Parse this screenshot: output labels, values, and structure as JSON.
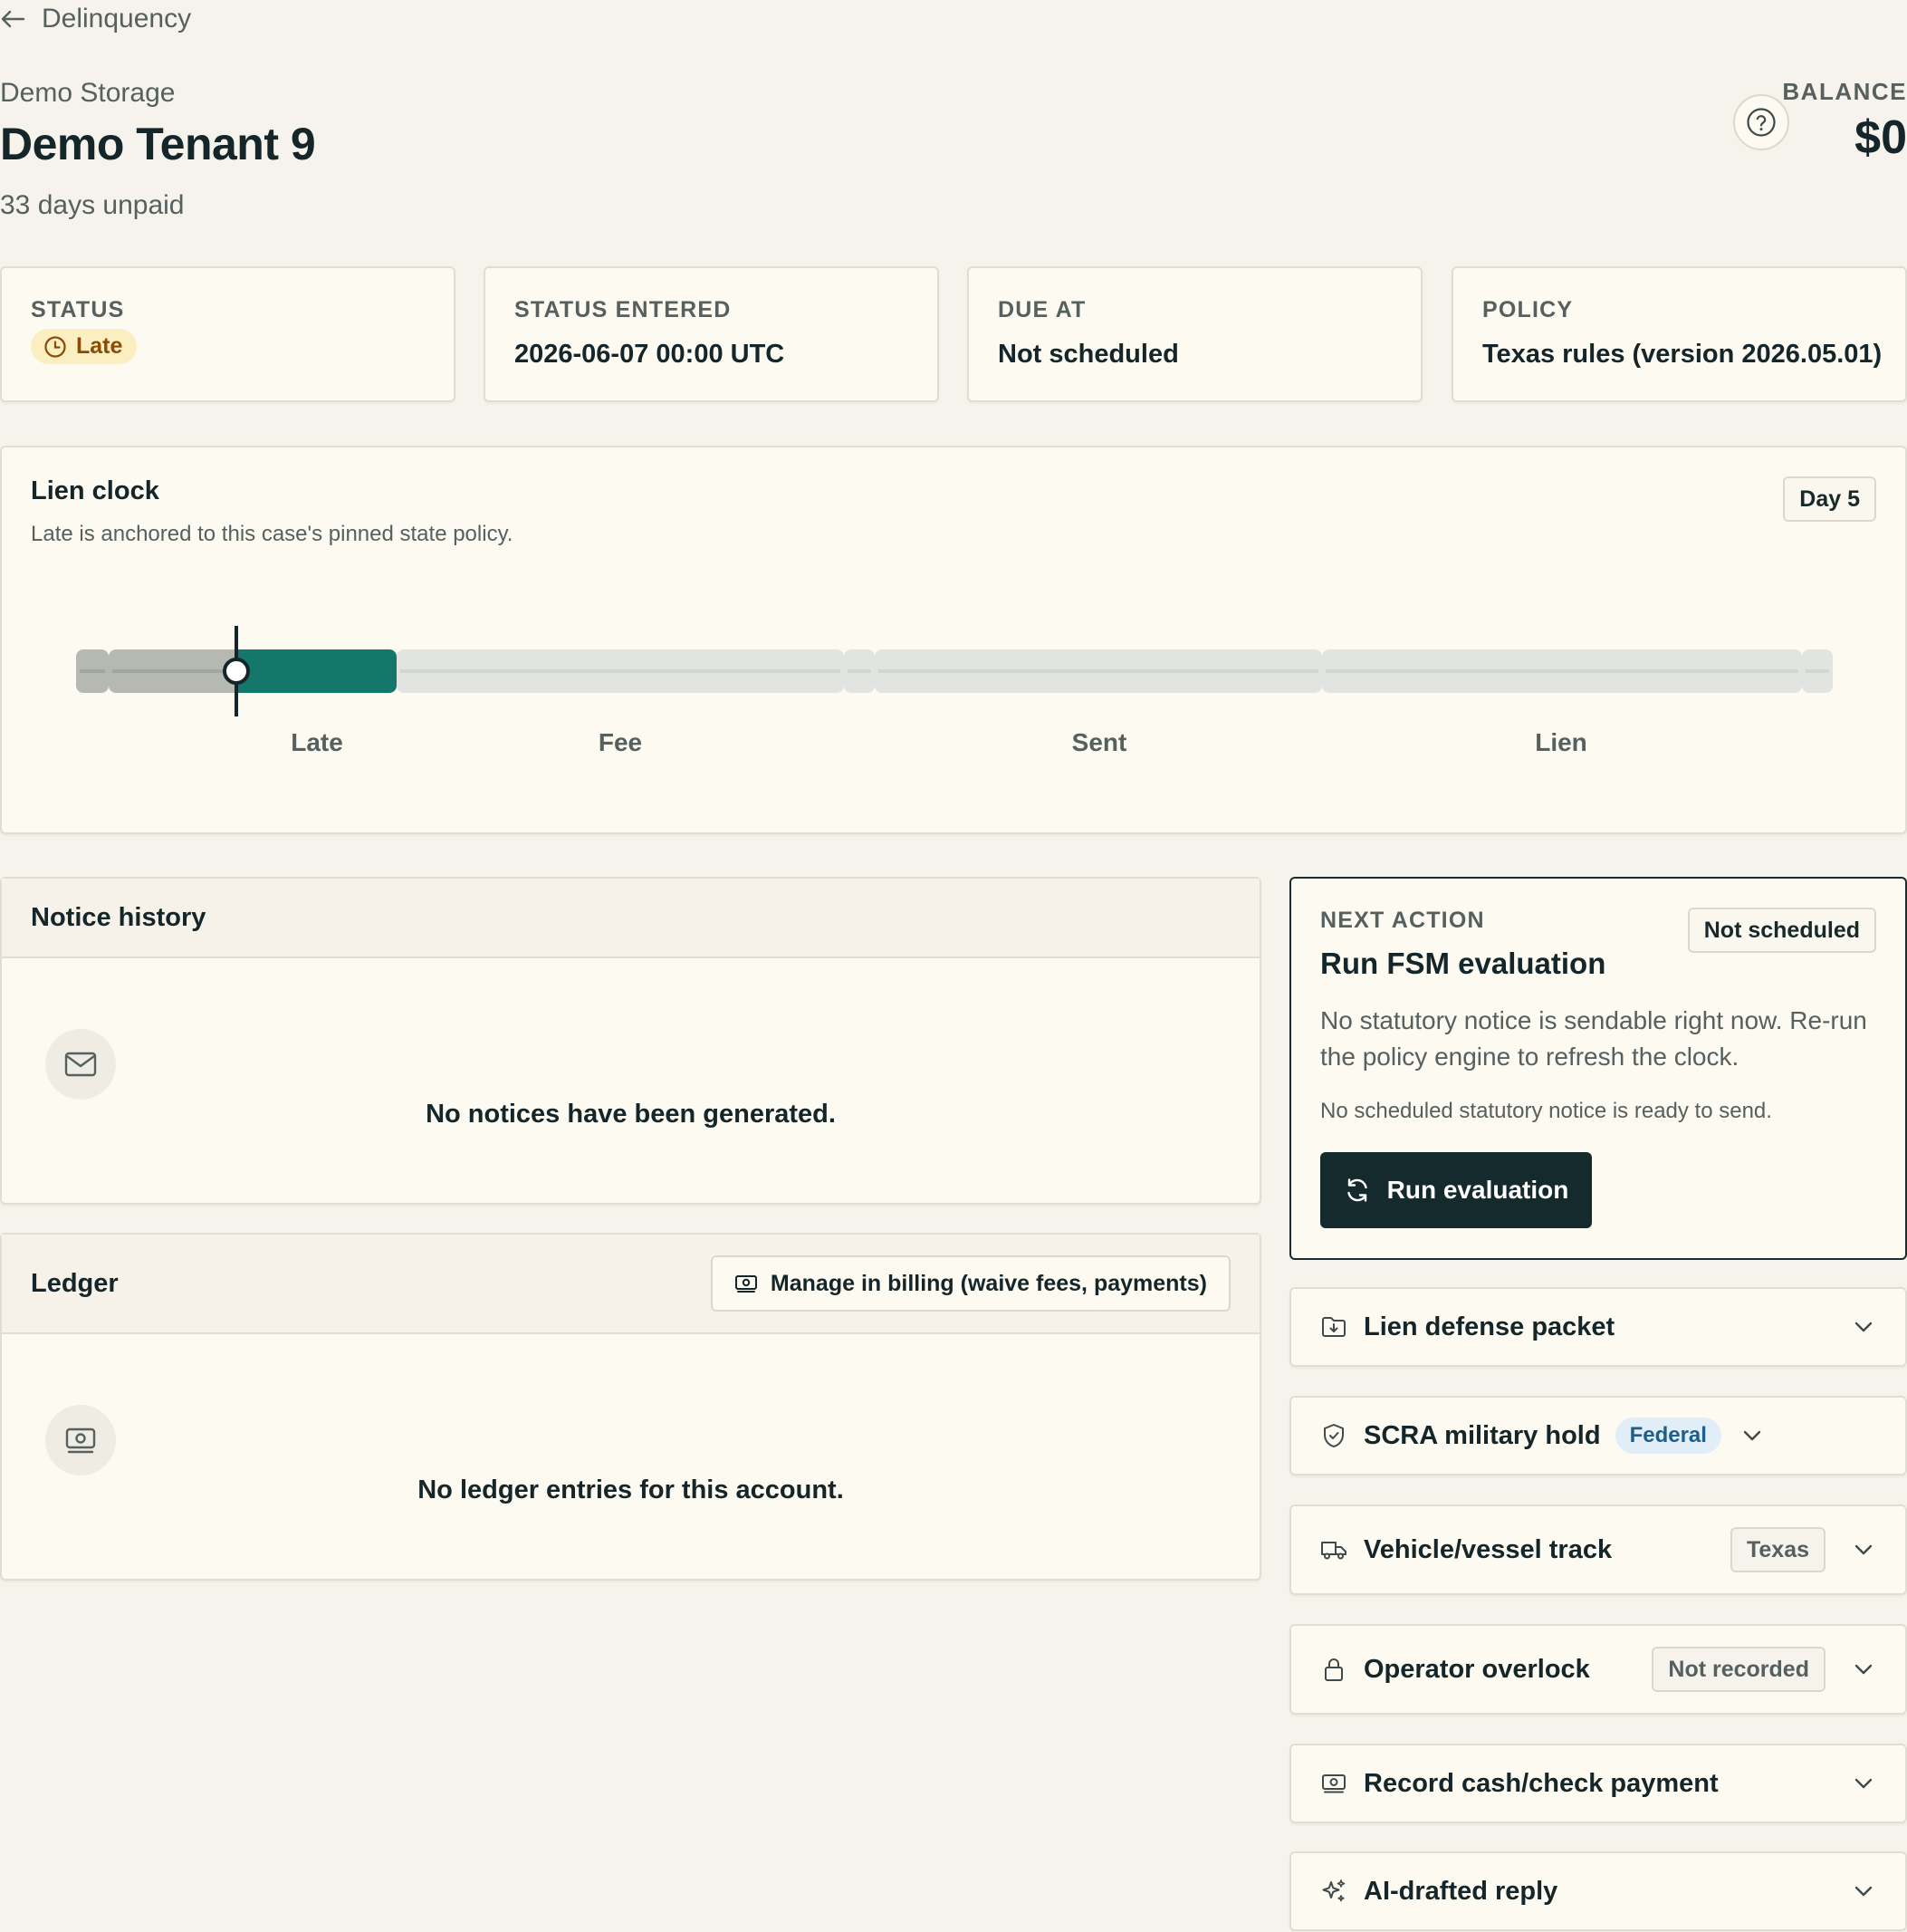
{
  "breadcrumb": {
    "back_label": "Delinquency"
  },
  "header": {
    "facility": "Demo Storage",
    "tenant_name": "Demo Tenant 9",
    "days_unpaid": "33 days unpaid",
    "balance_label": "BALANCE",
    "balance_value": "$0"
  },
  "stats": {
    "status": {
      "label": "STATUS",
      "value": "Late"
    },
    "status_entered": {
      "label": "STATUS ENTERED",
      "value": "2026-06-07 00:00 UTC"
    },
    "due_at": {
      "label": "DUE AT",
      "value": "Not scheduled"
    },
    "policy": {
      "label": "POLICY",
      "value": "Texas rules (version 2026.05.01)"
    }
  },
  "lien_clock": {
    "title": "Lien clock",
    "subtitle": "Late is anchored to this case's pinned state policy.",
    "day_badge": "Day 5",
    "stages": [
      "Late",
      "Fee",
      "Sent",
      "Lien"
    ],
    "colors": {
      "elapsed": "#b6b9b2",
      "current": "#15766a",
      "future": "#e2e4e1"
    }
  },
  "notice_history": {
    "title": "Notice history",
    "icon": "mail-icon",
    "empty_text": "No notices have been generated."
  },
  "ledger": {
    "title": "Ledger",
    "billing_button": "Manage in billing (waive fees, payments)",
    "icon": "cash-icon",
    "empty_text": "No ledger entries for this account."
  },
  "next_action": {
    "label": "NEXT ACTION",
    "badge": "Not scheduled",
    "title": "Run FSM evaluation",
    "description": "No statutory notice is sendable right now. Re-run the policy engine to refresh the clock.",
    "note": "No scheduled statutory notice is ready to send.",
    "button_label": "Run evaluation"
  },
  "accordions": [
    {
      "label": "Lien defense packet",
      "icon": "folder-download-icon"
    },
    {
      "label": "SCRA military hold",
      "icon": "shield-check-icon",
      "tag": "Federal"
    },
    {
      "label": "Vehicle/vessel track",
      "icon": "truck-icon",
      "tag": "Texas"
    },
    {
      "label": "Operator overlock",
      "icon": "lock-icon",
      "tag": "Not recorded"
    },
    {
      "label": "Record cash/check payment",
      "icon": "cash-icon"
    },
    {
      "label": "AI-drafted reply",
      "icon": "sparkles-icon"
    }
  ]
}
